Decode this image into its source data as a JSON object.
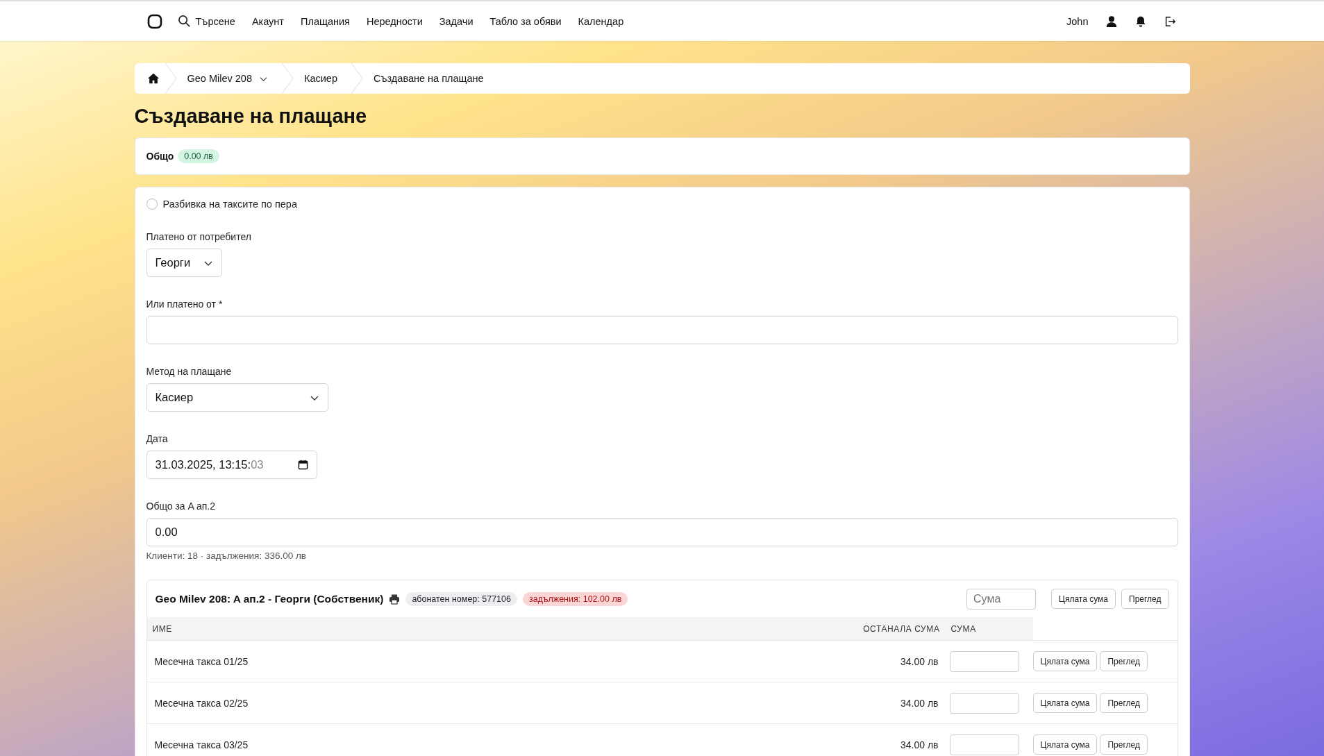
{
  "nav": {
    "search": "Търсене",
    "items": [
      "Акаунт",
      "Плащания",
      "Нередности",
      "Задачи",
      "Табло за обяви",
      "Календар"
    ],
    "user": "John"
  },
  "breadcrumb": [
    {
      "label": "Geo Milev 208",
      "dropdown": true
    },
    {
      "label": "Касиер",
      "dropdown": false
    },
    {
      "label": "Създаване на плащане",
      "dropdown": false
    }
  ],
  "title": "Създаване на плащане",
  "total": {
    "label": "Общо",
    "amount": "0.00 лв"
  },
  "form": {
    "split": {
      "label": "Разбивка на таксите по пера",
      "checked": false
    },
    "paid_by_user": {
      "label": "Платено от потребител",
      "value": "Георги"
    },
    "or_paid_by": {
      "label": "Или платено от *"
    },
    "method": {
      "label": "Метод на плащане",
      "value": "Касиер"
    },
    "date": {
      "label": "Дата",
      "value": "31.03.2025, 13:15:",
      "seconds": "03"
    },
    "sum": {
      "label": "Общо за A ап.2",
      "value": "0.00",
      "hint": "Клиенти: 18 · задължения: 336.00 лв"
    }
  },
  "account": {
    "title": "Geo Milev 208: A ап.2 - Георги (Собственик)",
    "subscriber": "абонатен номер: 577106",
    "debt": "задължения: 102.00 лв",
    "amount_placeholder": "Сума",
    "full_button": "Цялата сума",
    "view_button": "Преглед",
    "columns": [
      "ИМЕ",
      "ОСТАНАЛА СУМА",
      "СУМА"
    ],
    "rows": [
      {
        "name": "Месечна такса 01/25",
        "remaining": "34.00 лв",
        "full_button": "Цялата сума",
        "view_button": "Преглед"
      },
      {
        "name": "Месечна такса 02/25",
        "remaining": "34.00 лв",
        "full_button": "Цялата сума",
        "view_button": "Преглед"
      },
      {
        "name": "Месечна такса 03/25",
        "remaining": "34.00 лв",
        "full_button": "Цялата сума",
        "view_button": "Преглед"
      }
    ]
  }
}
